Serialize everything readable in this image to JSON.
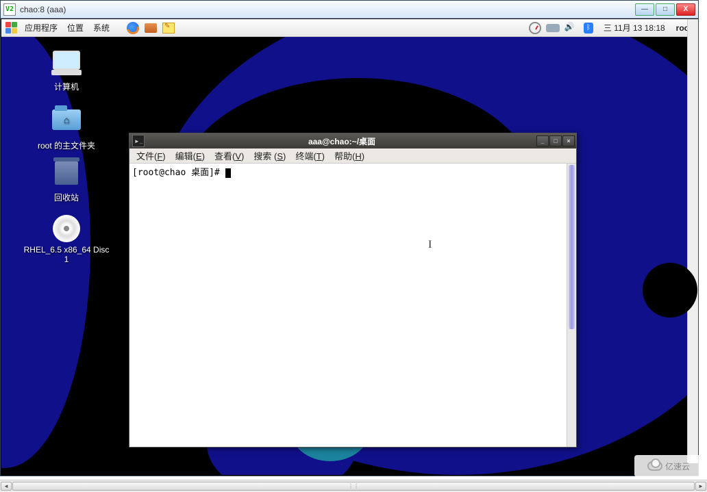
{
  "vnc": {
    "logo_text": "V2",
    "title": "chao:8 (aaa)",
    "min": "—",
    "max": "□",
    "close": "X"
  },
  "panel": {
    "menus": {
      "apps": "应用程序",
      "places": "位置",
      "system": "系统"
    },
    "clock": "三 11月 13 18:18",
    "user": "root"
  },
  "desktop_icons": {
    "computer": "计算机",
    "home": "root 的主文件夹",
    "trash": "回收站",
    "dvd": "RHEL_6.5 x86_64 Disc 1"
  },
  "terminal": {
    "title": "aaa@chao:~/桌面",
    "menus": {
      "file": "文件(<u>F</u>)",
      "edit": "编辑(<u>E</u>)",
      "view": "查看(<u>V</u>)",
      "search": "搜索 (<u>S</u>)",
      "term": "终端(<u>T</u>)",
      "help": "帮助(<u>H</u>)"
    },
    "prompt": "[root@chao 桌面]# ",
    "min": "_",
    "max": "□",
    "close": "×"
  },
  "watermark": "亿速云"
}
